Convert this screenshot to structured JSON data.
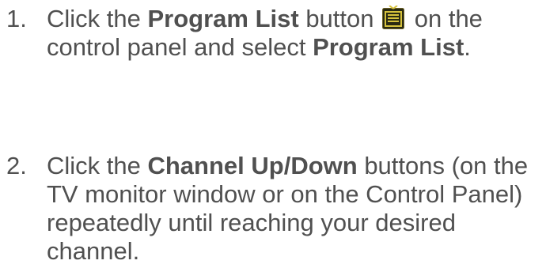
{
  "steps": [
    {
      "number": "1.",
      "lines": [
        [
          "Click the ",
          "Program List",
          " button ",
          " on the"
        ],
        [
          "control panel and select ",
          "Program List",
          "."
        ]
      ],
      "icon": "program-list-tv-icon"
    },
    {
      "number": "2.",
      "lines": [
        [
          "Click the ",
          "Channel Up/Down",
          " buttons (on the"
        ],
        [
          "TV monitor window or on the Control Panel)"
        ],
        [
          "repeatedly until reaching your desired"
        ],
        [
          "channel."
        ]
      ]
    }
  ],
  "colors": {
    "text": "#505050",
    "icon_bg": "#2a2a12",
    "icon_accent": "#d6c23c"
  }
}
